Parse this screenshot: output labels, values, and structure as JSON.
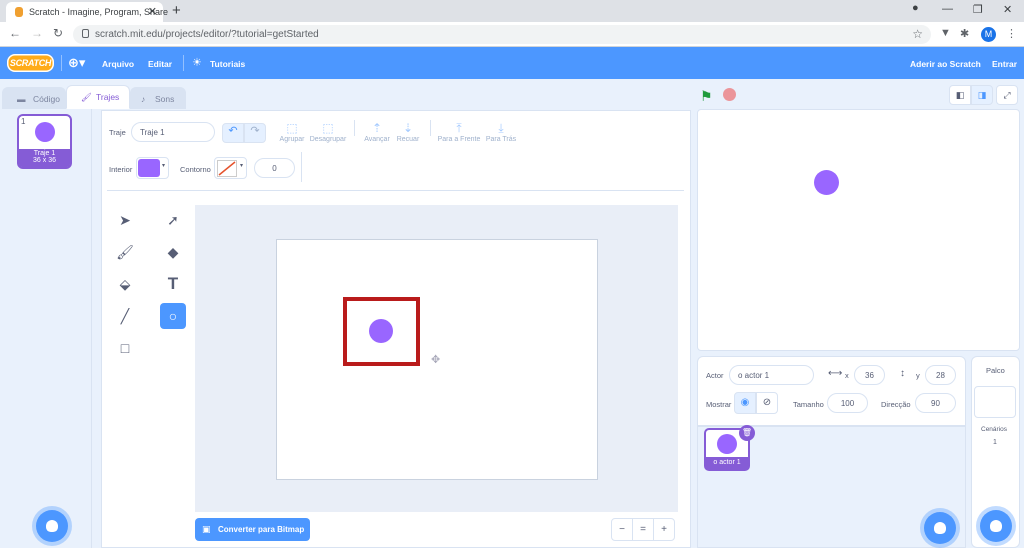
{
  "browser": {
    "tab_title": "Scratch - Imagine, Program, Share",
    "tab_close": "✕",
    "new_tab": "+",
    "url": "scratch.mit.edu/projects/editor/?tutorial=getStarted",
    "profile_initial": "M"
  },
  "menu": {
    "logo": "SCRATCH",
    "file": "Arquivo",
    "edit": "Editar",
    "tutorials": "Tutoriais",
    "join": "Aderir ao Scratch",
    "signin": "Entrar"
  },
  "tabs": {
    "code": "Código",
    "costumes": "Trajes",
    "sounds": "Sons"
  },
  "costume_list": [
    {
      "number": "1",
      "name": "Traje 1",
      "size": "36 x 36"
    }
  ],
  "paint": {
    "costume_label": "Traje",
    "costume_name": "Traje 1",
    "group": "Agrupar",
    "ungroup": "Desagrupar",
    "forward": "Avançar",
    "backward": "Recuar",
    "front": "Para a Frente",
    "back": "Para Trás",
    "fill_label": "Interior",
    "outline_label": "Contorno",
    "outline_width": "0",
    "fill_color": "#9966ff",
    "convert_button": "Converter para Bitmap",
    "zoom_out": "−",
    "zoom_reset": "=",
    "zoom_in": "+"
  },
  "sprite": {
    "label": "Actor",
    "name": "o actor 1",
    "x_label": "x",
    "x": "36",
    "y_label": "y",
    "y": "28",
    "show_label": "Mostrar",
    "size_label": "Tamanho",
    "size": "100",
    "direction_label": "Direcção",
    "direction": "90"
  },
  "sprite_list": [
    {
      "name": "o actor 1"
    }
  ],
  "stage_panel": {
    "title": "Palco",
    "backdrops_label": "Cenários",
    "backdrops_count": "1"
  },
  "colors": {
    "scratch_blue": "#4c97ff",
    "purple": "#855cd6",
    "sprite": "#9966ff",
    "highlight": "#b91b1b"
  }
}
